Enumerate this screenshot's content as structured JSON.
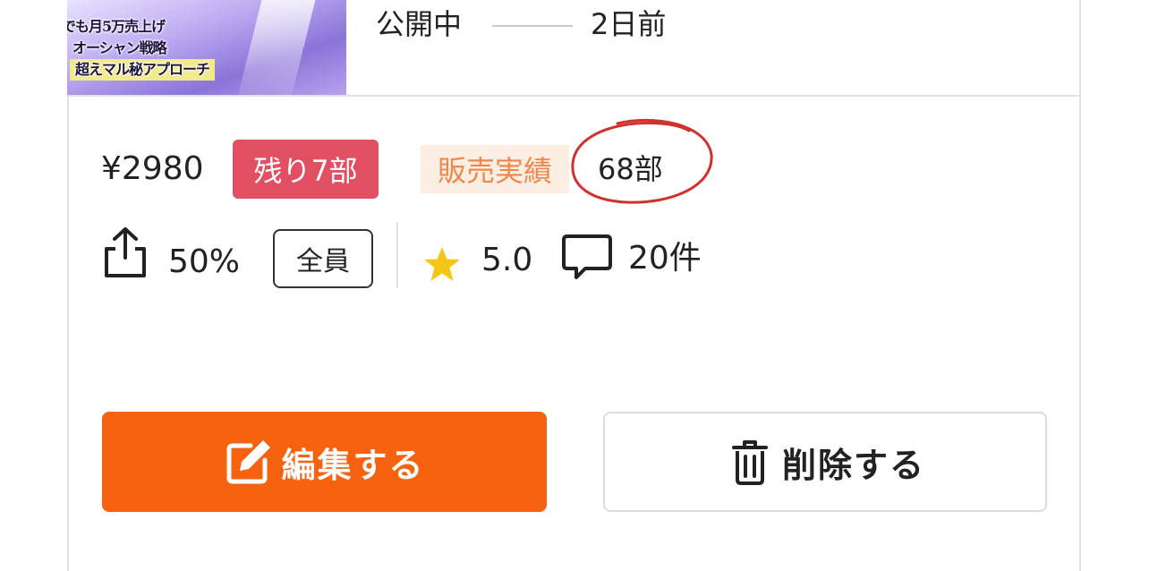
{
  "thumbnail": {
    "lines": [
      "でも月5万売上げ",
      "オーシャン戦略",
      "超えマル秘アプローチ"
    ]
  },
  "listing": {
    "status": "公開中",
    "published_ago": "2日前",
    "price": "¥2980",
    "remaining_badge": "残り7部",
    "sales_label": "販売実績",
    "sales_count": "68部",
    "share_percent": "50%",
    "audience_badge": "全員",
    "rating": "5.0",
    "comment_count": "20件"
  },
  "actions": {
    "edit_label": "編集する",
    "delete_label": "削除する"
  },
  "colors": {
    "edit_button": "#f6620f",
    "remaining_badge": "#e05062",
    "sales_label_bg": "#fdeee3",
    "sales_label_text": "#f0884a",
    "star": "#f5c518",
    "annotation_circle": "#d0312d"
  },
  "icons": {
    "share": "share-icon",
    "star": "star-icon",
    "comment": "comment-icon",
    "edit": "edit-icon",
    "trash": "trash-icon"
  }
}
